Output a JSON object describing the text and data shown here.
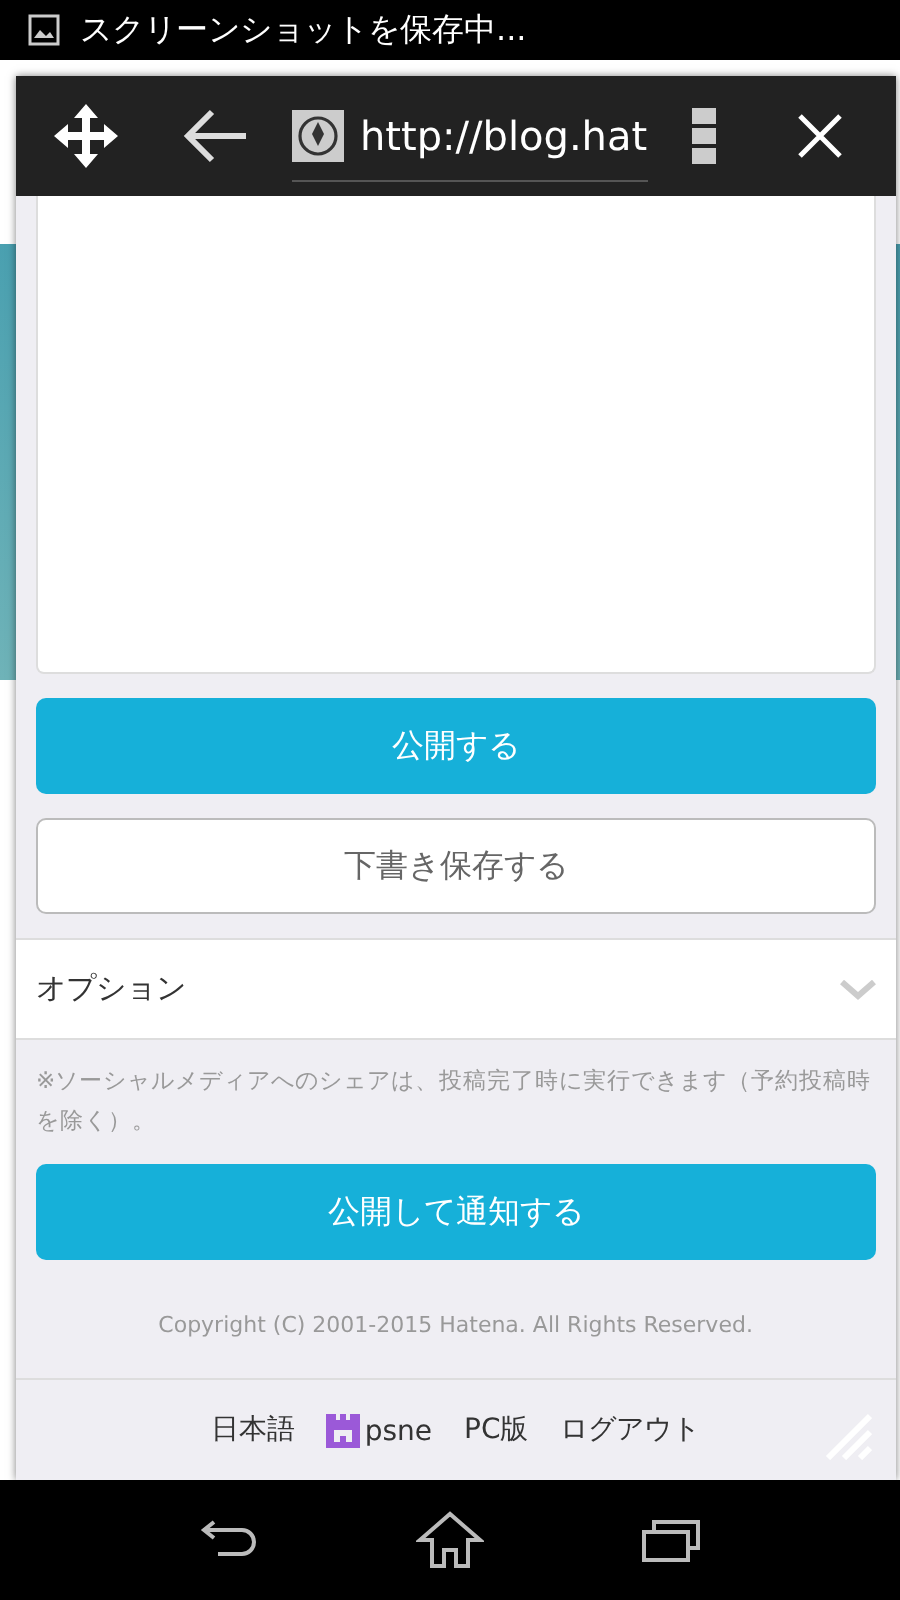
{
  "status_bar": {
    "notification": "スクリーンショットを保存中..."
  },
  "browser_toolbar": {
    "url": "http://blog.hat"
  },
  "editor": {
    "publish_button": "公開する",
    "draft_button": "下書き保存する"
  },
  "options": {
    "label": "オプション",
    "expanded": false
  },
  "note": "※ソーシャルメディアへのシェアは、投稿完了時に実行できます（予約投稿時を除く）。",
  "publish_notify_button": "公開して通知する",
  "copyright": "Copyright (C) 2001-2015 Hatena. All Rights Reserved.",
  "footer_links": [
    {
      "kind": "text",
      "label": "日本語"
    },
    {
      "kind": "user",
      "label": "psne"
    },
    {
      "kind": "text",
      "label": "PC版"
    },
    {
      "kind": "text",
      "label": "ログアウト"
    }
  ]
}
